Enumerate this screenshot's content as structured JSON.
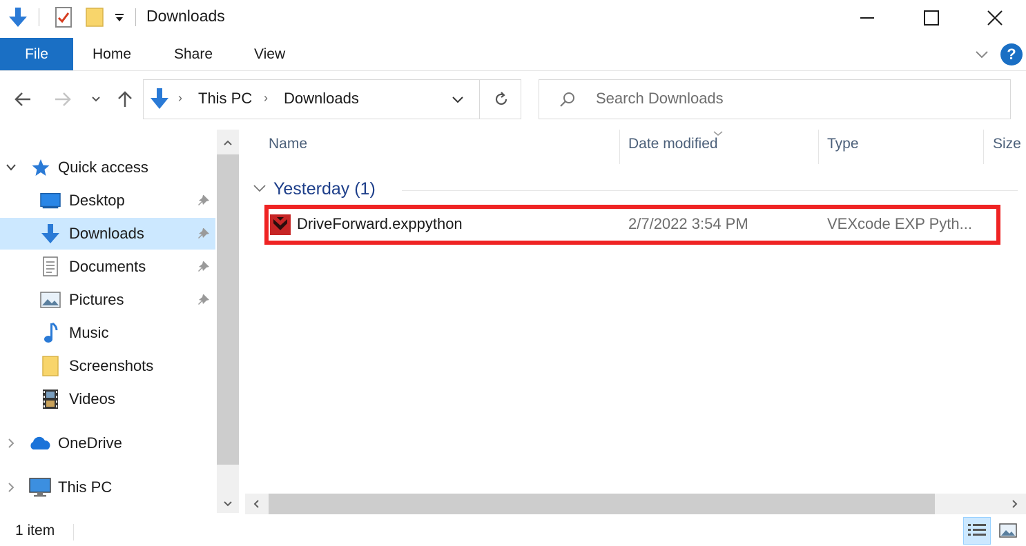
{
  "window": {
    "title": "Downloads",
    "minimize_glyph": "—",
    "maximize_glyph": "☐",
    "close_glyph": "✕"
  },
  "ribbon": {
    "tabs": [
      "File",
      "Home",
      "Share",
      "View"
    ],
    "help_label": "?"
  },
  "address_bar": {
    "crumbs": [
      "This PC",
      "Downloads"
    ],
    "search_placeholder": "Search Downloads"
  },
  "nav_pane": {
    "quick_access": "Quick access",
    "items": [
      "Desktop",
      "Downloads",
      "Documents",
      "Pictures",
      "Music",
      "Screenshots",
      "Videos"
    ],
    "onedrive": "OneDrive",
    "this_pc": "This PC"
  },
  "content": {
    "columns": [
      "Name",
      "Date modified",
      "Type",
      "Size"
    ],
    "group": "Yesterday (1)",
    "files": [
      {
        "name": "DriveForward.exppython",
        "date": "2/7/2022 3:54 PM",
        "type": "VEXcode EXP Pyth..."
      }
    ]
  },
  "status_bar": {
    "item_count": "1 item"
  },
  "colors": {
    "accent": "#1a6fc4",
    "selection": "#cce8ff",
    "highlight_box": "#ef2323",
    "group_header": "#1e3f8a"
  }
}
